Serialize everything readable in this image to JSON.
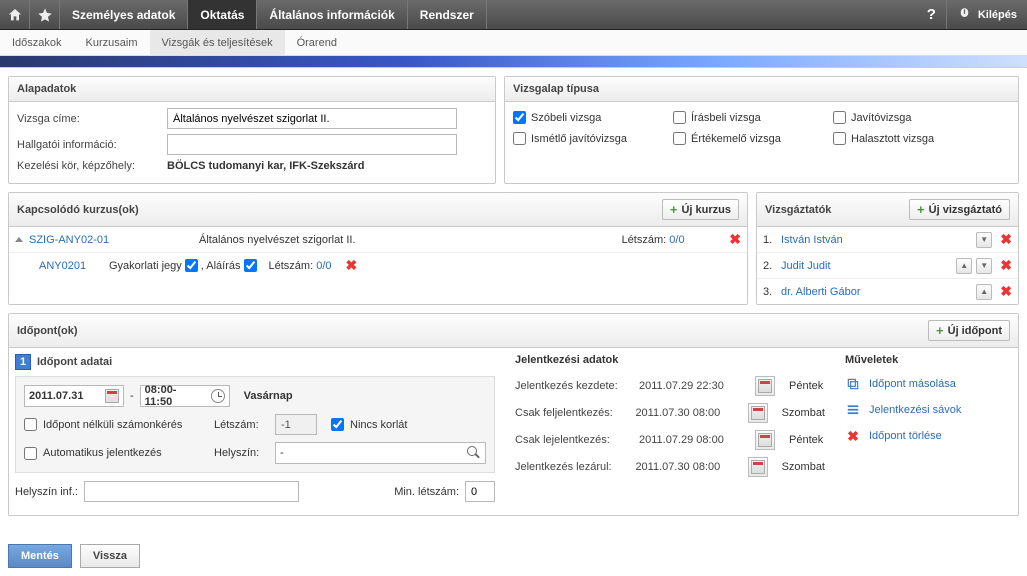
{
  "topmenu": {
    "items": [
      "Személyes adatok",
      "Oktatás",
      "Általános információk",
      "Rendszer"
    ],
    "active": 1,
    "help": "?",
    "logout": "Kilépés"
  },
  "submenu": {
    "items": [
      "Időszakok",
      "Kurzusaim",
      "Vizsgák és teljesítések",
      "Órarend"
    ],
    "active": 2
  },
  "basedata": {
    "title": "Alapadatok",
    "exam_title_label": "Vizsga címe:",
    "exam_title_value": "Általános nyelvészet szigorlat II.",
    "student_info_label": "Hallgatói információ:",
    "student_info_value": "",
    "scope_label": "Kezelési kör, képzőhely:",
    "scope_value": "BÖLCS tudomanyi kar, IFK-Szekszárd"
  },
  "examtypes": {
    "title": "Vizsgalap típusa",
    "opts": [
      {
        "label": "Szóbeli vizsga",
        "checked": true
      },
      {
        "label": "Írásbeli vizsga",
        "checked": false
      },
      {
        "label": "Javítóvizsga",
        "checked": false
      },
      {
        "label": "Ismétlő javítóvizsga",
        "checked": false
      },
      {
        "label": "Értékemelő vizsga",
        "checked": false
      },
      {
        "label": "Halasztott vizsga",
        "checked": false
      }
    ]
  },
  "courses": {
    "title": "Kapcsolódó kurzus(ok)",
    "add": "Új kurzus",
    "parent": {
      "code": "SZIG-ANY02-01",
      "name": "Általános nyelvészet szigorlat II.",
      "count_label": "Létszám:",
      "count": "0/0"
    },
    "child": {
      "code": "ANY0201",
      "grade_label": "Gyakorlati jegy",
      "sign_label": ", Aláírás",
      "count_label": "Létszám:",
      "count": "0/0"
    }
  },
  "examiners": {
    "title": "Vizsgáztatók",
    "add": "Új vizsgáztató",
    "rows": [
      {
        "n": "1.",
        "name": "István István",
        "up": false,
        "down": true
      },
      {
        "n": "2.",
        "name": "Judit Judit",
        "up": true,
        "down": true
      },
      {
        "n": "3.",
        "name": "dr. Alberti Gábor",
        "up": true,
        "down": false
      }
    ]
  },
  "times": {
    "title": "Időpont(ok)",
    "add": "Új időpont",
    "num": "1",
    "detail_title": "Időpont adatai",
    "date": "2011.07.31",
    "sep": "-",
    "time": "08:00-11:50",
    "day": "Vasárnap",
    "noexam_label": "Időpont nélküli számonkérés",
    "auto_label": "Automatikus jelentkezés",
    "count_label": "Létszám:",
    "count_value": "-1",
    "nolimit_label": "Nincs korlát",
    "loc_label": "Helyszín:",
    "loc_value": "-",
    "locinf_label": "Helyszín inf.:",
    "locinf_value": "",
    "min_label": "Min. létszám:",
    "min_value": "0"
  },
  "signup": {
    "title": "Jelentkezési adatok",
    "rows": [
      {
        "l": "Jelentkezés kezdete:",
        "v": "2011.07.29 22:30",
        "d": "Péntek"
      },
      {
        "l": "Csak feljelentkezés:",
        "v": "2011.07.30 08:00",
        "d": "Szombat"
      },
      {
        "l": "Csak lejelentkezés:",
        "v": "2011.07.29 08:00",
        "d": "Péntek"
      },
      {
        "l": "Jelentkezés lezárul:",
        "v": "2011.07.30 08:00",
        "d": "Szombat"
      }
    ]
  },
  "ops": {
    "title": "Műveletek",
    "copy": "Időpont másolása",
    "slots": "Jelentkezési sávok",
    "del": "Időpont törlése"
  },
  "footer": {
    "save": "Mentés",
    "back": "Vissza"
  }
}
